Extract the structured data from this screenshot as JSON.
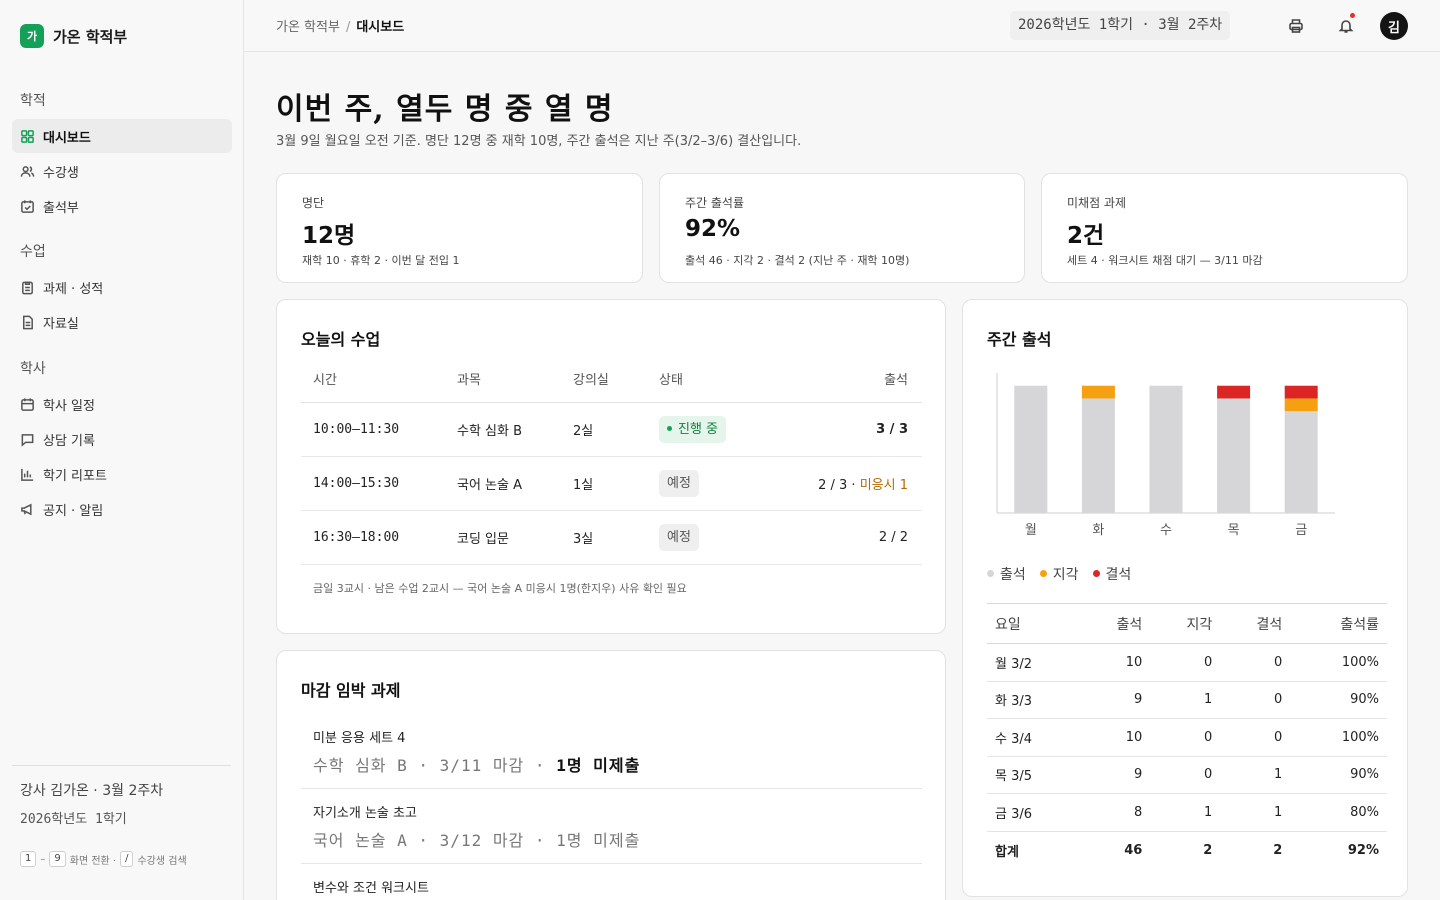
{
  "brand": {
    "mark": "가",
    "name": "가온 학적부"
  },
  "nav": {
    "groups": [
      {
        "title": "학적",
        "items": [
          {
            "label": "대시보드",
            "icon": "grid-icon"
          },
          {
            "label": "수강생",
            "icon": "users-icon"
          },
          {
            "label": "출석부",
            "icon": "calendar-check-icon"
          }
        ]
      },
      {
        "title": "수업",
        "items": [
          {
            "label": "과제 · 성적",
            "icon": "clipboard-icon"
          },
          {
            "label": "자료실",
            "icon": "file-icon"
          }
        ]
      },
      {
        "title": "학사",
        "items": [
          {
            "label": "학사 일정",
            "icon": "calendar-icon"
          },
          {
            "label": "상담 기록",
            "icon": "chat-icon"
          },
          {
            "label": "학기 리포트",
            "icon": "bar-chart-icon"
          },
          {
            "label": "공지 · 알림",
            "icon": "megaphone-icon"
          }
        ]
      }
    ]
  },
  "sidebar_footer": {
    "line1": "강사 김가온 · 3월 2주차",
    "line2": "2026학년도 1학기",
    "key_1": "1",
    "key_range_sep": "–",
    "key_9": "9",
    "switch_label": "화면 전환 ·",
    "key_slash": "/",
    "search_label": "수강생 검색"
  },
  "breadcrumb": {
    "root": "가온 학적부",
    "sep": "/",
    "current": "대시보드"
  },
  "term": "2026학년도 1학기 · 3월 2주차",
  "avatar": "김",
  "headline": "이번 주, 열두 명 중 열 명",
  "subline": "3월 9일 월요일 오전 기준. 명단 12명 중 재학 10명, 주간 출석은 지난 주(3/2–3/6) 결산입니다.",
  "stats": [
    {
      "label": "명단",
      "value": "12명",
      "foot": "재학 10 · 휴학 2 · 이번 달 전입 1"
    },
    {
      "label": "주간 출석률",
      "value": "92%",
      "foot": "출석 46 · 지각 2 · 결석 2 (지난 주 · 재학 10명)"
    },
    {
      "label": "미채점 과제",
      "value": "2건",
      "foot": "세트 4 · 워크시트 채점 대기 — 3/11 마감"
    }
  ],
  "classes": {
    "title": "오늘의 수업",
    "headers": [
      "시간",
      "과목",
      "강의실",
      "상태",
      "출석"
    ],
    "rows": [
      {
        "time": "10:00–11:30",
        "subject": "수학 심화 B",
        "room": "2실",
        "status": "진행 중",
        "attend": "3 / 3",
        "note": ""
      },
      {
        "time": "14:00–15:30",
        "subject": "국어 논술 A",
        "room": "1실",
        "status": "예정",
        "attend": "2 / 3 ·",
        "note": "미응시 1"
      },
      {
        "time": "16:30–18:00",
        "subject": "코딩 입문",
        "room": "3실",
        "status": "예정",
        "attend": "2 / 2",
        "note": ""
      }
    ],
    "note": "금일 3교시 · 남은 수업 2교시 — 국어 논술 A 미응시 1명(한지우) 사유 확인 필요"
  },
  "deadlines": {
    "title": "마감 임박 과제",
    "items": [
      {
        "name": "미분 응용 세트 4",
        "meta": "수학 심화 B · 3/11 마감 ·",
        "missing": "1명 미제출"
      },
      {
        "name": "자기소개 논술 초고",
        "meta": "국어 논술 A · 3/12 마감 · 1명 미제출",
        "missing": ""
      },
      {
        "name": "변수와 조건 워크시트",
        "meta": "",
        "missing": ""
      }
    ]
  },
  "weekly": {
    "title": "주간 출석",
    "legend": [
      "출석",
      "지각",
      "결석"
    ],
    "headers": [
      "요일",
      "출석",
      "지각",
      "결석",
      "출석률"
    ],
    "rows": [
      {
        "day": "월 3/2",
        "present": "10",
        "late": "0",
        "absent": "0",
        "rate": "100%"
      },
      {
        "day": "화 3/3",
        "present": "9",
        "late": "1",
        "absent": "0",
        "rate": "90%"
      },
      {
        "day": "수 3/4",
        "present": "10",
        "late": "0",
        "absent": "0",
        "rate": "100%"
      },
      {
        "day": "목 3/5",
        "present": "9",
        "late": "0",
        "absent": "1",
        "rate": "90%"
      },
      {
        "day": "금 3/6",
        "present": "8",
        "late": "1",
        "absent": "1",
        "rate": "80%"
      }
    ],
    "total": {
      "day": "합계",
      "present": "46",
      "late": "2",
      "absent": "2",
      "rate": "92%"
    }
  },
  "chart_data": {
    "type": "bar",
    "stacked": true,
    "categories": [
      "월",
      "화",
      "수",
      "목",
      "금"
    ],
    "series": [
      {
        "name": "출석",
        "values": [
          10,
          9,
          10,
          9,
          8
        ],
        "color": "#d6d6d9"
      },
      {
        "name": "지각",
        "values": [
          0,
          1,
          0,
          0,
          1
        ],
        "color": "#f5a010"
      },
      {
        "name": "결석",
        "values": [
          0,
          0,
          0,
          1,
          1
        ],
        "color": "#dc2626"
      }
    ],
    "ylim": [
      0,
      11
    ],
    "grid": false
  },
  "colors": {
    "accent": "#15a058",
    "late": "#f5a010",
    "absent": "#dc2626",
    "present": "#d6d6d9"
  }
}
